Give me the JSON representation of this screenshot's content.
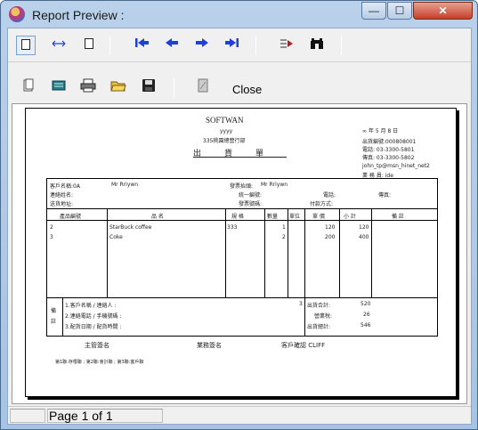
{
  "window": {
    "title": "Report Preview :"
  },
  "titlebar_buttons": {
    "minimize": "—",
    "maximize": "☐",
    "close": "✕"
  },
  "toolbar": {
    "close_label": "Close"
  },
  "report": {
    "company": "SOFTWAN",
    "subtitle_year": "yyyy",
    "department": "335桃園總營行部",
    "doc_title": "出貨單",
    "date_line": "∞  年   5  月   8  日",
    "right_info": [
      "出貨編號:000808001",
      "電話:   03-3300-5801",
      "傳真:   03-3300-5802",
      "john_tp@msn_hinet_net2",
      "業 務 員: ide"
    ],
    "customer": {
      "name_label": "客戶名稱:0A",
      "name_value": "Mr Rriywn",
      "contact_label": "連絡姓名:",
      "address_label": "送貨地址:",
      "delivery_label": "發票抬頭:",
      "delivery_value": "Mr Rriywn",
      "tax_label": "統一編號:",
      "phone_label": "電話:",
      "fax_label": "傳真:",
      "invoice_label": "發票號碼:",
      "payment_label": "付款方式:"
    },
    "columns": [
      "產品編號",
      "品    名",
      "規    格",
      "數量",
      "單位",
      "單  價",
      "小    計",
      "備    註"
    ],
    "rows": [
      {
        "code": "2",
        "name": "StarBuck coffee",
        "spec": "333",
        "qty": "1",
        "price": "120",
        "subtotal": "120"
      },
      {
        "code": "3",
        "name": "Coke",
        "spec": "",
        "qty": "2",
        "price": "200",
        "subtotal": "400"
      }
    ],
    "notes_label": "備註",
    "notes": [
      "1.客戶名稱 / 連絡人   :",
      "2.連絡電話 / 手機號碼 :",
      "3.配貨日期 / 配貨時間 :"
    ],
    "notes_num": "3",
    "totals": [
      {
        "label": "出貨合計:",
        "value": "520"
      },
      {
        "label": "營業稅:",
        "value": "26"
      },
      {
        "label": "出貨總計:",
        "value": "546"
      }
    ],
    "signatures": [
      "主管簽名",
      "業務簽名",
      "客戶確認 CLIFF"
    ],
    "footer_note": "第1聯:存根聯 ; 第2聯:會計聯 ; 第3聯:客戶聯"
  },
  "status": {
    "page_text": "Page 1 of 1"
  }
}
